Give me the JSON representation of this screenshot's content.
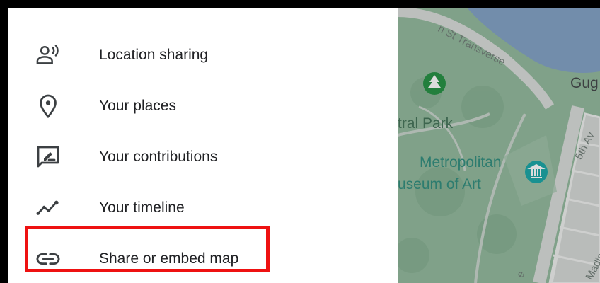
{
  "menu": {
    "items": [
      {
        "label": "Location sharing",
        "icon": "location-sharing-icon"
      },
      {
        "label": "Your places",
        "icon": "location-pin-icon"
      },
      {
        "label": "Your contributions",
        "icon": "contributions-icon"
      },
      {
        "label": "Your timeline",
        "icon": "timeline-icon"
      },
      {
        "label": "Share or embed map",
        "icon": "link-icon"
      }
    ],
    "highlight_color": "#ee1111"
  },
  "map": {
    "labels": {
      "park": "tral Park",
      "museum_line1": "Metropolitan",
      "museum_line2": "useum of Art",
      "guggenheim": "Gug",
      "transverse": "n St Transverse",
      "fifth_ave": "5th Av",
      "madison": "Madiso",
      "e_street": "e"
    },
    "colors": {
      "park": "#8fb89a",
      "water": "#7e9fc4",
      "museum_text": "#2a8a7a",
      "park_text": "#3f6f54",
      "road": "#d8dcd9"
    }
  }
}
